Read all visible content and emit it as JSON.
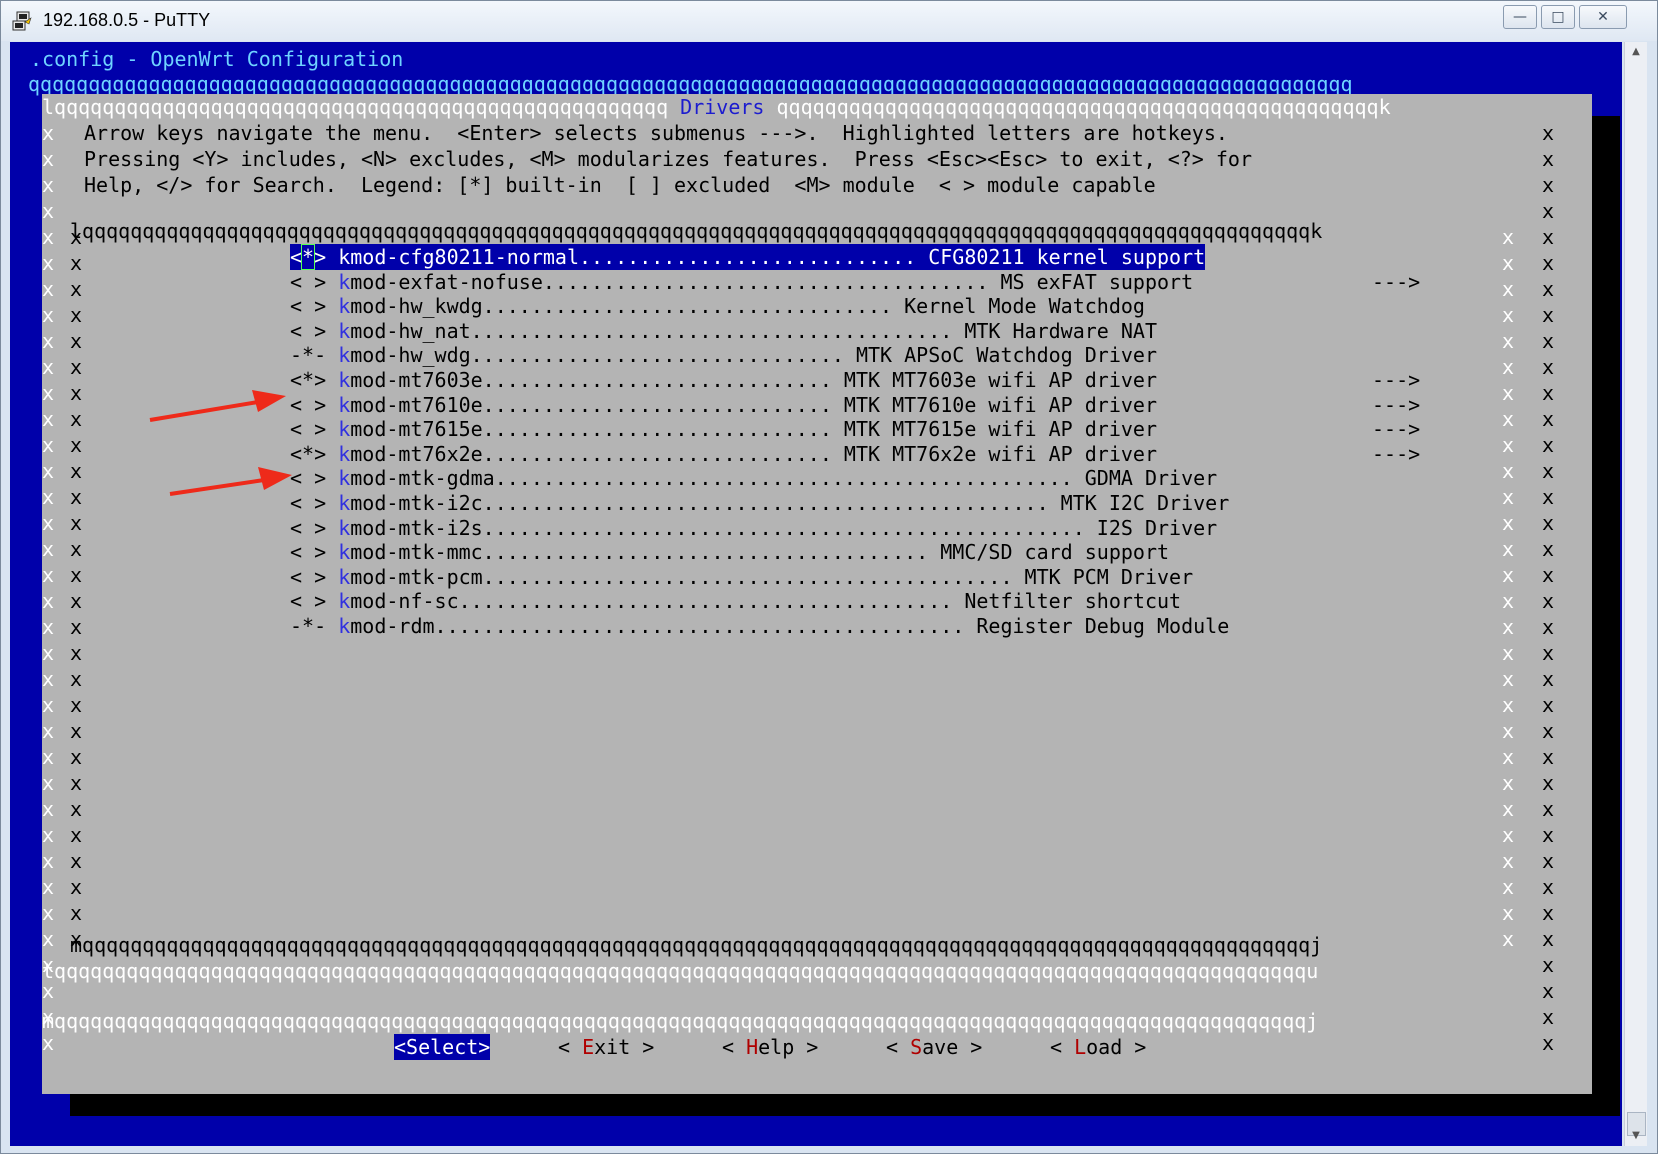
{
  "window": {
    "title": "192.168.0.5 - PuTTY",
    "minimize": "—",
    "maximize": "□",
    "close": "✕"
  },
  "terminal": {
    "config_title": ".config - OpenWrt Configuration",
    "top_rule": "qqqqqqqqqqqqqqqqqqqqqqqqqqqqqqqqqqqqqqqqqqqqqqqqqqqqqqqqqqqqqqqqqqqqqqqqqqqqqqqqqqqqqqqqqqqqqqqqqqqqqqqqqqqqqq"
  },
  "dialog": {
    "top_left": "lqqqqqqqqqqqqqqqqqqqqqqqqqqqqqqqqqqqqqqqqqqqqqqqqqqq",
    "title": " Drivers ",
    "top_right": "qqqqqqqqqqqqqqqqqqqqqqqqqqqqqqqqqqqqqqqqqqqqqqqqqqk",
    "help_lines": [
      "Arrow keys navigate the menu.  <Enter> selects submenus --->.  Highlighted letters are hotkeys.",
      "Pressing <Y> includes, <N> excludes, <M> modularizes features.  Press <Esc><Esc> to exit, <?> for",
      "Help, </> for Search.  Legend: [*] built-in  [ ] excluded  <M> module  < > module capable"
    ],
    "inner_top": "lqqqqqqqqqqqqqqqqqqqqqqqqqqqqqqqqqqqqqqqqqqqqqqqqqqqqqqqqqqqqqqqqqqqqqqqqqqqqqqqqqqqqqqqqqqqqqqqqqqqqqqk",
    "inner_bottom": "mqqqqqqqqqqqqqqqqqqqqqqqqqqqqqqqqqqqqqqqqqqqqqqqqqqqqqqqqqqqqqqqqqqqqqqqqqqqqqqqqqqqqqqqqqqqqqqqqqqqqqqj",
    "separator": "tqqqqqqqqqqqqqqqqqqqqqqqqqqqqqqqqqqqqqqqqqqqqqqqqqqqqqqqqqqqqqqqqqqqqqqqqqqqqqqqqqqqqqqqqqqqqqqqqqqqqqqqqu",
    "bottom": "mqqqqqqqqqqqqqqqqqqqqqqqqqqqqqqqqqqqqqqqqqqqqqqqqqqqqqqqqqqqqqqqqqqqqqqqqqqqqqqqqqqqqqqqqqqqqqqqqqqqqqqqqj",
    "border_char": "x"
  },
  "menu_items": [
    {
      "state_l": "<",
      "state_m": "*",
      "state_r": ">",
      "hot": "k",
      "rest": "mod-cfg80211-normal............................ CFG80211 kernel support",
      "arrow": "",
      "selected": true
    },
    {
      "state_l": "<",
      "state_m": " ",
      "state_r": ">",
      "hot": "k",
      "rest": "mod-exfat-nofuse..................................... MS exFAT support",
      "arrow": "--->",
      "selected": false
    },
    {
      "state_l": "<",
      "state_m": " ",
      "state_r": ">",
      "hot": "k",
      "rest": "mod-hw_kwdg.................................. Kernel Mode Watchdog",
      "arrow": "",
      "selected": false
    },
    {
      "state_l": "<",
      "state_m": " ",
      "state_r": ">",
      "hot": "k",
      "rest": "mod-hw_nat........................................ MTK Hardware NAT",
      "arrow": "",
      "selected": false
    },
    {
      "state_l": "-",
      "state_m": "*",
      "state_r": "-",
      "hot": "k",
      "rest": "mod-hw_wdg............................... MTK APSoC Watchdog Driver",
      "arrow": "",
      "selected": false
    },
    {
      "state_l": "<",
      "state_m": "*",
      "state_r": ">",
      "hot": "k",
      "rest": "mod-mt7603e............................. MTK MT7603e wifi AP driver",
      "arrow": "--->",
      "selected": false
    },
    {
      "state_l": "<",
      "state_m": " ",
      "state_r": ">",
      "hot": "k",
      "rest": "mod-mt7610e............................. MTK MT7610e wifi AP driver",
      "arrow": "--->",
      "selected": false
    },
    {
      "state_l": "<",
      "state_m": " ",
      "state_r": ">",
      "hot": "k",
      "rest": "mod-mt7615e............................. MTK MT7615e wifi AP driver",
      "arrow": "--->",
      "selected": false
    },
    {
      "state_l": "<",
      "state_m": "*",
      "state_r": ">",
      "hot": "k",
      "rest": "mod-mt76x2e............................. MTK MT76x2e wifi AP driver",
      "arrow": "--->",
      "selected": false
    },
    {
      "state_l": "<",
      "state_m": " ",
      "state_r": ">",
      "hot": "k",
      "rest": "mod-mtk-gdma................................................ GDMA Driver",
      "arrow": "",
      "selected": false
    },
    {
      "state_l": "<",
      "state_m": " ",
      "state_r": ">",
      "hot": "k",
      "rest": "mod-mtk-i2c............................................... MTK I2C Driver",
      "arrow": "",
      "selected": false
    },
    {
      "state_l": "<",
      "state_m": " ",
      "state_r": ">",
      "hot": "k",
      "rest": "mod-mtk-i2s.................................................. I2S Driver",
      "arrow": "",
      "selected": false
    },
    {
      "state_l": "<",
      "state_m": " ",
      "state_r": ">",
      "hot": "k",
      "rest": "mod-mtk-mmc..................................... MMC/SD card support",
      "arrow": "",
      "selected": false
    },
    {
      "state_l": "<",
      "state_m": " ",
      "state_r": ">",
      "hot": "k",
      "rest": "mod-mtk-pcm............................................ MTK PCM Driver",
      "arrow": "",
      "selected": false
    },
    {
      "state_l": "<",
      "state_m": " ",
      "state_r": ">",
      "hot": "k",
      "rest": "mod-nf-sc......................................... Netfilter shortcut",
      "arrow": "",
      "selected": false
    },
    {
      "state_l": "-",
      "state_m": "*",
      "state_r": "-",
      "hot": "k",
      "rest": "mod-rdm............................................ Register Debug Module",
      "arrow": "",
      "selected": false
    }
  ],
  "buttons": {
    "select": "<Select>",
    "exit_pre": "< ",
    "exit_hk": "E",
    "exit_post": "xit >",
    "help_pre": "< ",
    "help_hk": "H",
    "help_post": "elp >",
    "save_pre": "< ",
    "save_hk": "S",
    "save_post": "ave >",
    "load_pre": "< ",
    "load_hk": "L",
    "load_post": "oad >"
  },
  "colors": {
    "terminal_bg": "#0000aa",
    "dialog_bg": "#b4b4b4",
    "hotkey": "#3030e0",
    "button_hotkey": "#b00000",
    "annotation_arrow": "#ee2a1a"
  }
}
